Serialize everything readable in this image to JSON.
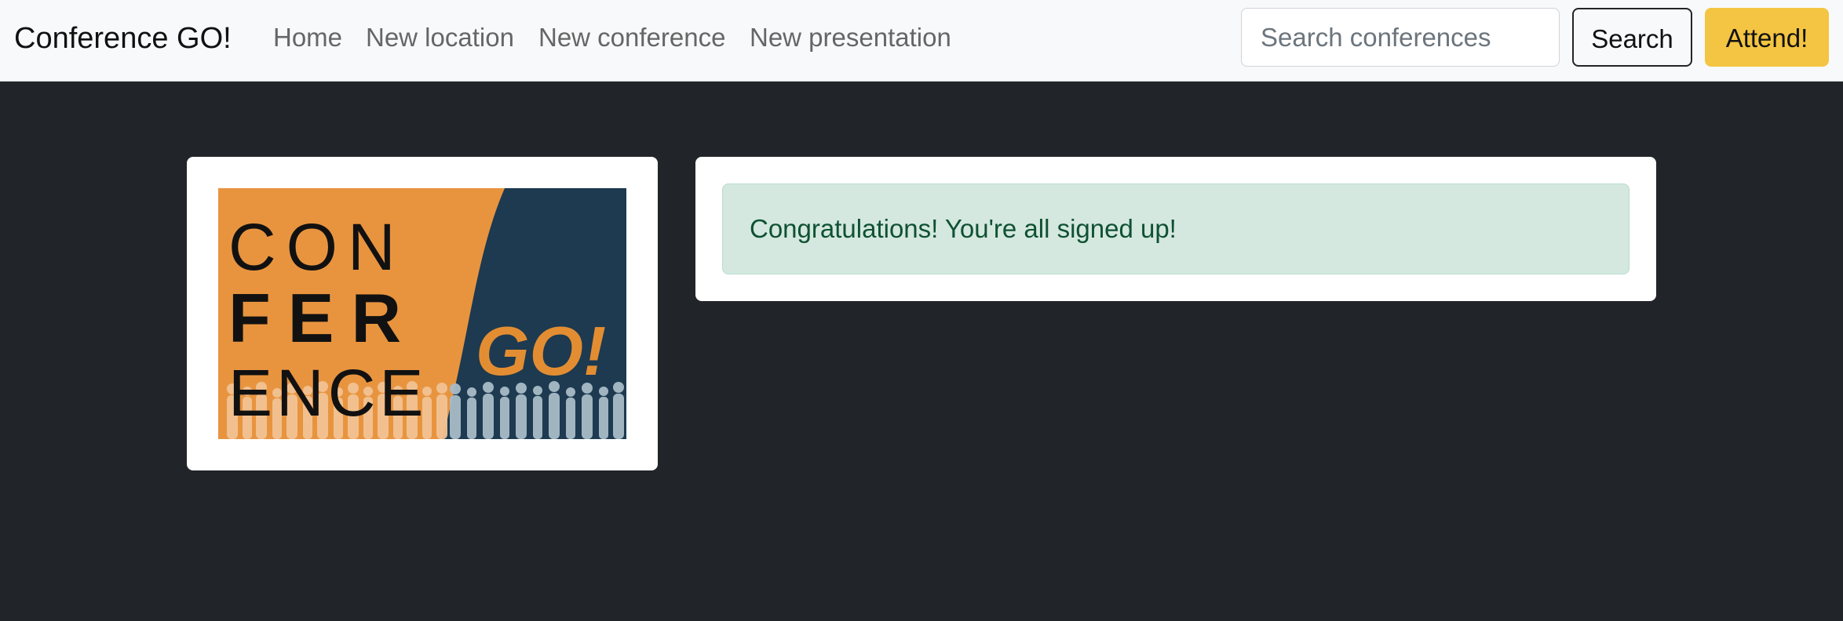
{
  "navbar": {
    "brand": "Conference GO!",
    "links": [
      {
        "label": "Home"
      },
      {
        "label": "New location"
      },
      {
        "label": "New conference"
      },
      {
        "label": "New presentation"
      }
    ],
    "search": {
      "placeholder": "Search conferences",
      "button_label": "Search"
    },
    "attend_button_label": "Attend!"
  },
  "logo": {
    "line1": "CON",
    "line2": "FER",
    "line3": "ENCE",
    "accent": "GO!"
  },
  "message": {
    "text": "Congratulations! You're all signed up!"
  },
  "colors": {
    "navbar_background": "#f8f9fa",
    "page_background": "#212529",
    "attend_button": "#f4c542",
    "logo_orange": "#e8943f",
    "logo_navy": "#1d3a50",
    "success_background": "#d4e8df",
    "success_text": "#0f5132"
  }
}
